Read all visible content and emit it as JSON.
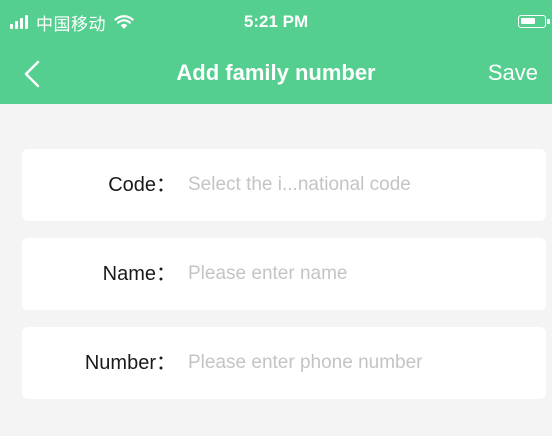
{
  "status_bar": {
    "carrier": "中国移动",
    "time": "5:21 PM"
  },
  "nav": {
    "title": "Add family number",
    "save_label": "Save"
  },
  "form": {
    "code": {
      "label": "Code：",
      "placeholder": "Select the i...national code"
    },
    "name": {
      "label": "Name：",
      "placeholder": "Please enter name"
    },
    "number": {
      "label": "Number：",
      "placeholder": "Please enter phone number"
    }
  },
  "colors": {
    "accent": "#55cf8f",
    "background": "#f4f4f4",
    "placeholder": "#c4c4c4"
  },
  "icons": [
    "signal-icon",
    "wifi-icon",
    "battery-icon",
    "back-chevron-icon"
  ]
}
